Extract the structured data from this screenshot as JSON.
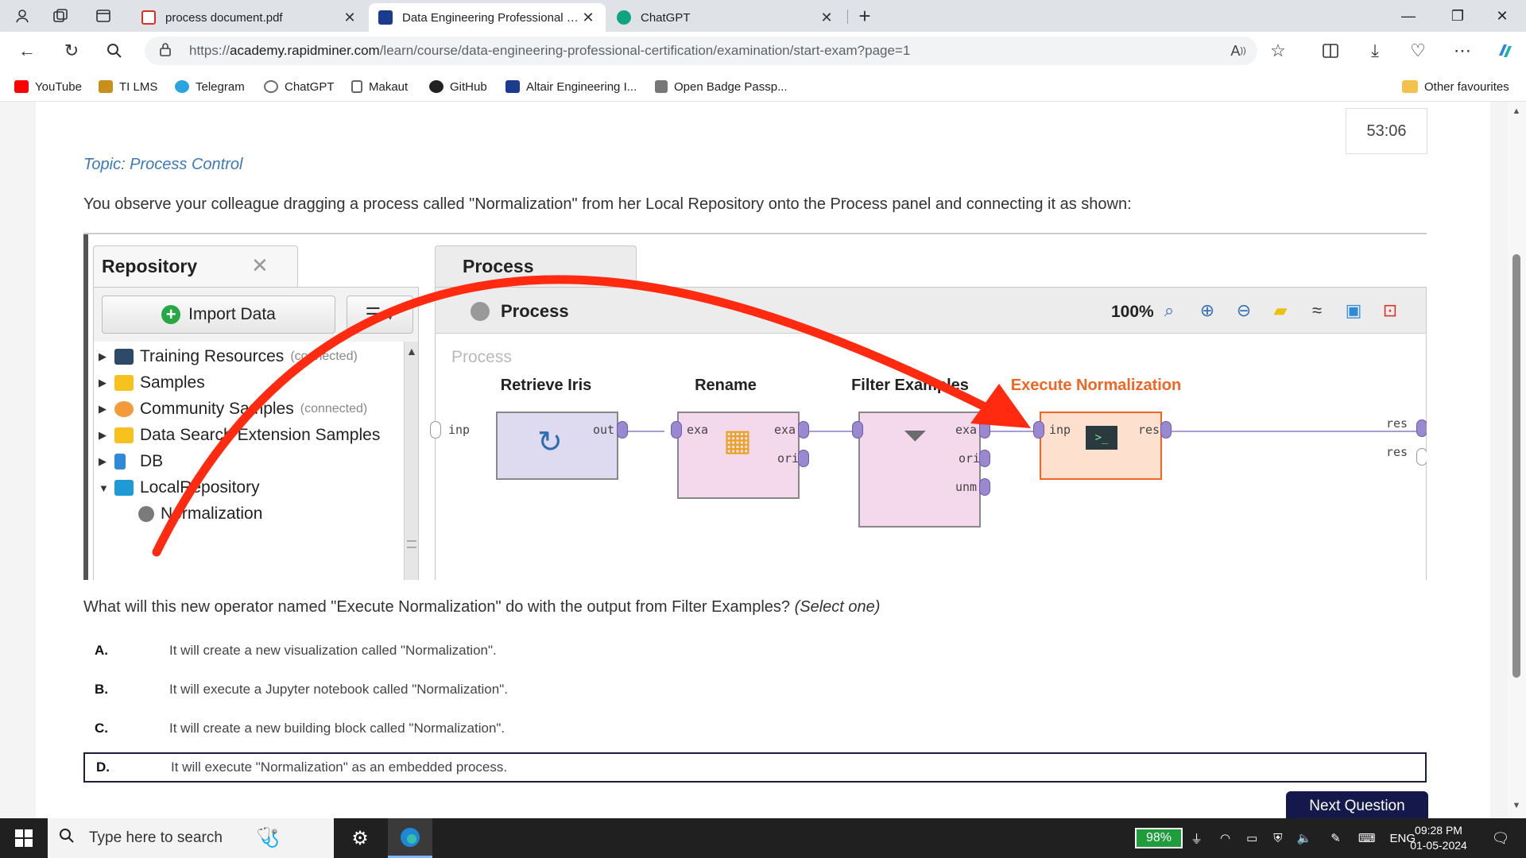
{
  "browser": {
    "tabs": [
      {
        "title": "process document.pdf",
        "close": "✕",
        "active": false,
        "favicon_color": "#d93025"
      },
      {
        "title": "Data Engineering Professional Ce",
        "close": "✕",
        "active": true,
        "favicon_color": "#1b3c8c"
      },
      {
        "title": "ChatGPT",
        "close": "✕",
        "active": false,
        "favicon_color": "#10a37f"
      }
    ],
    "new_tab": "+",
    "window_controls": {
      "minimize": "—",
      "maximize": "❐",
      "close": "✕"
    },
    "address": {
      "prefix": "https://",
      "host": "academy.rapidminer.com",
      "path": "/learn/course/data-engineering-professional-certification/examination/start-exam?page=1"
    },
    "bookmarks": [
      {
        "label": "YouTube",
        "color": "#ff0000"
      },
      {
        "label": "TI LMS",
        "color": "#c8901a"
      },
      {
        "label": "Telegram",
        "color": "#2aa3df"
      },
      {
        "label": "ChatGPT",
        "color": "#6b6b6b"
      },
      {
        "label": "Makaut",
        "color": "#666666"
      },
      {
        "label": "GitHub",
        "color": "#222222"
      },
      {
        "label": "Altair Engineering I...",
        "color": "#1b3c8c"
      },
      {
        "label": "Open Badge Passp...",
        "color": "#777777"
      }
    ],
    "other_favourites": "Other favourites"
  },
  "exam": {
    "timer": "53:06",
    "topic": "Topic: Process Control",
    "question": "You observe your colleague dragging a process called \"Normalization\" from her Local Repository onto the Process panel and connecting it as shown:",
    "prompt": "What will this new operator named \"Execute Normalization\" do with the output from Filter Examples?",
    "prompt_hint": "(Select one)",
    "options": [
      {
        "letter": "A.",
        "text": "It will create a new visualization called \"Normalization\"."
      },
      {
        "letter": "B.",
        "text": "It will execute a Jupyter notebook called \"Normalization\"."
      },
      {
        "letter": "C.",
        "text": "It will create a new building block called \"Normalization\"."
      },
      {
        "letter": "D.",
        "text": "It will execute \"Normalization\" as an embedded process.",
        "selected": true
      }
    ],
    "next_button": "Next Question"
  },
  "rapidminer": {
    "repository": {
      "tab_title": "Repository",
      "close": "✕",
      "import_label": "Import Data",
      "menu": "☰ ▾",
      "items": [
        {
          "label": "Training Resources",
          "status": "(connected)",
          "expanded": false,
          "icon_color": "#2e4a6b"
        },
        {
          "label": "Samples",
          "status": "",
          "expanded": false,
          "icon_color": "#f7c21e"
        },
        {
          "label": "Community Samples",
          "status": "(connected)",
          "expanded": false,
          "icon_color": "#f39a3b"
        },
        {
          "label": "Data Search Extension Samples",
          "status": "",
          "expanded": false,
          "icon_color": "#f7c21e"
        },
        {
          "label": "DB",
          "status": "",
          "expanded": false,
          "icon_color": "#2f8ad8"
        },
        {
          "label": "LocalRepository",
          "status": "",
          "expanded": true,
          "icon_color": "#1e9ad6"
        },
        {
          "label": "Normalization",
          "status": "",
          "child": true,
          "icon_color": "#7a7a7a"
        }
      ]
    },
    "process": {
      "tab_title": "Process",
      "header_title": "Process",
      "zoom": "100%",
      "canvas_label": "Process",
      "operators": [
        {
          "name": "Retrieve Iris",
          "in_ports": [],
          "out_ports": [
            "out"
          ],
          "icon": "↻"
        },
        {
          "name": "Rename",
          "in_ports": [
            "exa"
          ],
          "out_ports": [
            "exa",
            "ori"
          ],
          "icon": "▦"
        },
        {
          "name": "Filter Examples",
          "in_ports": [],
          "out_ports": [
            "exa",
            "ori",
            "unm"
          ],
          "icon": "⏷"
        },
        {
          "name": "Execute Normalization",
          "in_ports": [
            "inp"
          ],
          "out_ports": [
            "res"
          ],
          "icon": ">_"
        }
      ],
      "input_port": "inp",
      "result_ports": [
        "res",
        "res"
      ]
    }
  },
  "taskbar": {
    "search_placeholder": "Type here to search",
    "battery": "98%",
    "language": "ENG",
    "time": "09:28 PM",
    "date": "01-05-2024"
  },
  "colors": {
    "annotation_arrow": "#ff2a10",
    "next_button": "#14184a",
    "topic_text": "#3d79b8",
    "selected_border": "#1b1f3b",
    "operator_highlight": "#f26522"
  }
}
